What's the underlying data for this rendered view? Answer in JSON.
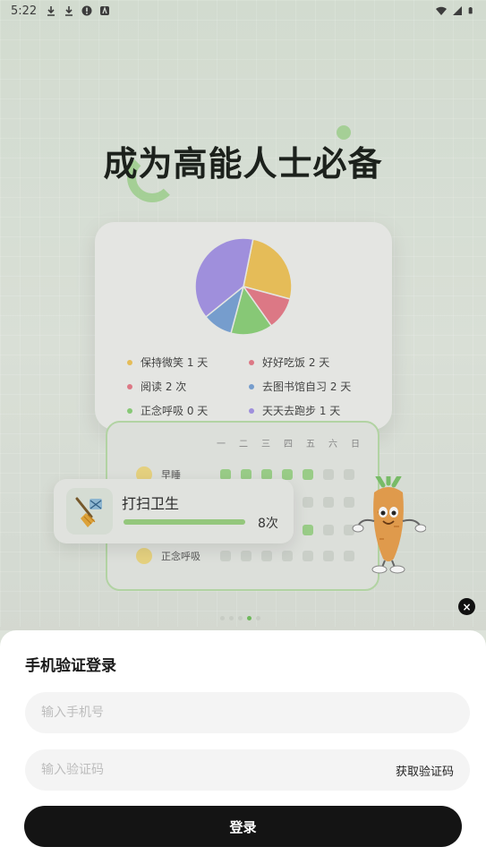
{
  "status_bar": {
    "time": "5:22",
    "icons": [
      "download-icon",
      "download-icon",
      "alert-icon",
      "app-icon"
    ],
    "right_icons": [
      "wifi-icon",
      "signal-icon",
      "battery-icon"
    ]
  },
  "hero": {
    "headline": "成为高能人士必备"
  },
  "stats_card": {
    "chart_data": {
      "type": "pie",
      "slices": [
        {
          "label": "保持微笑 1 天",
          "value": 0.26,
          "color": "#f0c45a"
        },
        {
          "label": "好好吃饭 2 天",
          "value": 0.11,
          "color": "#e67c8a"
        },
        {
          "label": "阅读 2 次",
          "value": 0.14,
          "color": "#8cd17a"
        },
        {
          "label": "去图书馆自习 2 天",
          "value": 0.1,
          "color": "#7aa3d6"
        },
        {
          "label": "正念呼吸 0 天",
          "value": 0.0,
          "color": "#9fd58c"
        },
        {
          "label": "天天去跑步 1 天",
          "value": 0.39,
          "color": "#a594e6"
        }
      ]
    },
    "legend": [
      {
        "text": "保持微笑 1 天",
        "color": "#f0c45a"
      },
      {
        "text": "好好吃饭 2 天",
        "color": "#e67c8a"
      },
      {
        "text": "阅读 2 次",
        "color": "#e67c8a"
      },
      {
        "text": "去图书馆自习 2 天",
        "color": "#7aa3d6"
      },
      {
        "text": "正念呼吸 0 天",
        "color": "#8cd17a"
      },
      {
        "text": "天天去跑步 1 天",
        "color": "#a594e6"
      }
    ]
  },
  "week_card": {
    "days": [
      "一",
      "二",
      "三",
      "四",
      "五",
      "六",
      "日"
    ],
    "rows": [
      {
        "name": "早睡",
        "done": [
          1,
          1,
          1,
          1,
          1,
          0,
          0
        ]
      },
      {
        "name": "",
        "done": [
          0,
          0,
          0,
          0,
          0,
          0,
          0
        ]
      },
      {
        "name": "",
        "done": [
          0,
          0,
          0,
          0,
          1,
          0,
          0
        ]
      },
      {
        "name": "正念呼吸",
        "done": [
          0,
          0,
          0,
          0,
          0,
          0,
          0
        ]
      }
    ]
  },
  "task_card": {
    "title": "打扫卫生",
    "count": "8次",
    "progress": 1.0
  },
  "pagination": {
    "count": 5,
    "active_index": 3
  },
  "close_label": "×",
  "login_sheet": {
    "title": "手机验证登录",
    "phone_placeholder": "输入手机号",
    "phone_value": "",
    "code_placeholder": "输入验证码",
    "code_value": "",
    "get_code_label": "获取验证码",
    "login_label": "登录"
  },
  "colors": {
    "accent_green": "#9fd58c",
    "button_black": "#141414"
  }
}
